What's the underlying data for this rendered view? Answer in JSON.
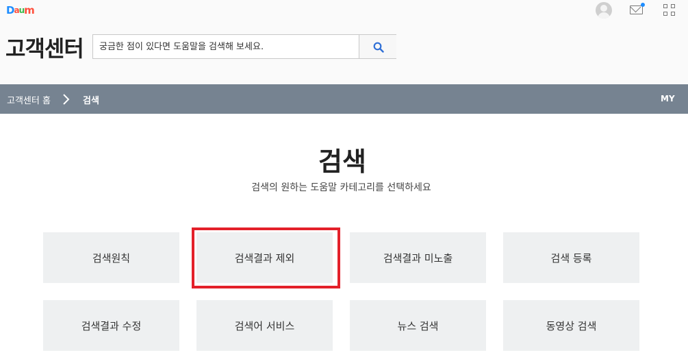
{
  "header": {
    "logo": {
      "letters": [
        "D",
        "a",
        "u",
        "m"
      ],
      "colors": [
        "#1e8dff",
        "#ff4f3c",
        "#3ab84a",
        "#ff4f3c"
      ]
    },
    "title": "고객센터",
    "icons": [
      "profile-icon",
      "mail-icon",
      "app-grid-icon"
    ]
  },
  "search": {
    "placeholder": "궁금한 점이 있다면 도움말을 검색해 보세요.",
    "value": "",
    "button_icon": "search-icon"
  },
  "breadcrumb": {
    "home": "고객센터 홈",
    "current": "검색",
    "my": "MY",
    "bar_color": "#768391"
  },
  "main": {
    "title": "검색",
    "description": "검색의 원하는 도움말 카테고리를 선택하세요",
    "categories": [
      {
        "label": "검색원칙"
      },
      {
        "label": "검색결과 제외"
      },
      {
        "label": "검색결과 미노출"
      },
      {
        "label": "검색 등록"
      },
      {
        "label": "검색결과 수정"
      },
      {
        "label": "검색어 서비스"
      },
      {
        "label": "뉴스 검색"
      },
      {
        "label": "동영상 검색"
      }
    ],
    "highlighted": "검색결과 제외",
    "highlight_color": "#e3202a"
  }
}
